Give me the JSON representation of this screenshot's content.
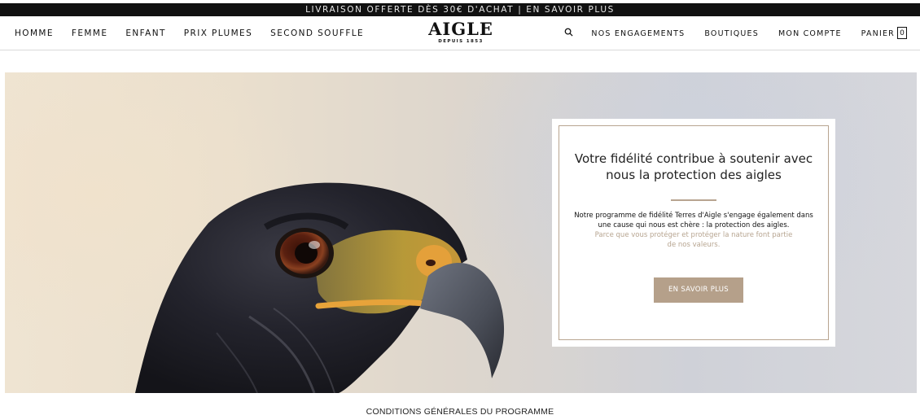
{
  "announcement": "LIVRAISON OFFERTE DÈS 30€ D'ACHAT | EN SAVOIR PLUS",
  "nav_left": [
    "HOMME",
    "FEMME",
    "ENFANT",
    "PRIX PLUMES",
    "SECOND SOUFFLE"
  ],
  "logo": {
    "name": "AIGLE",
    "since": "DEPUIS 1853"
  },
  "nav_right": {
    "search_icon": "search-icon",
    "engagements": "NOS ENGAGEMENTS",
    "boutiques": "BOUTIQUES",
    "account": "MON COMPTE",
    "cart": "PANIER",
    "cart_count": "0"
  },
  "hero": {
    "image": "eagle-head-photo",
    "title": "Votre fidélité contribue à soutenir avec nous la protection des aigles",
    "text": "Notre programme de fidélité Terres d'Aigle s'engage également dans une cause qui nous est chère : la protection des aigles.",
    "subtext": "Parce que vous protéger et protéger la nature font partie de nos valeurs.",
    "button": "EN SAVOIR PLUS"
  },
  "footer_link": "CONDITIONS GÉNÉRALES DU PROGRAMME",
  "colors": {
    "accent": "#b5a08a",
    "topbar": "#111111",
    "sub_text": "#b7a591"
  }
}
